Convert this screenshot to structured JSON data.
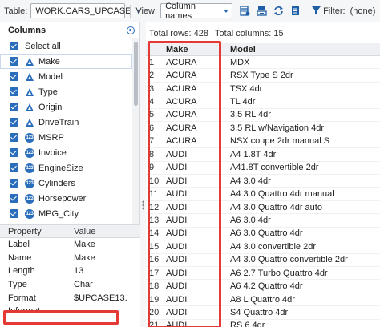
{
  "toolbar": {
    "table_label": "Table:",
    "table_value": "WORK.CARS_UPCASE",
    "view_label": "View:",
    "view_value": "Column names",
    "filter_label": "Filter:",
    "filter_value": "(none)",
    "icons": [
      "table-properties-icon",
      "export-icon",
      "refresh-icon",
      "column-list-icon",
      "filter-icon"
    ]
  },
  "columns_panel": {
    "title": "Columns",
    "select_all": "Select all",
    "items": [
      {
        "label": "Make",
        "type": "char"
      },
      {
        "label": "Model",
        "type": "char"
      },
      {
        "label": "Type",
        "type": "char"
      },
      {
        "label": "Origin",
        "type": "char"
      },
      {
        "label": "DriveTrain",
        "type": "char"
      },
      {
        "label": "MSRP",
        "type": "num"
      },
      {
        "label": "Invoice",
        "type": "num"
      },
      {
        "label": "EngineSize",
        "type": "num"
      },
      {
        "label": "Cylinders",
        "type": "num"
      },
      {
        "label": "Horsepower",
        "type": "num"
      },
      {
        "label": "MPG_City",
        "type": "num"
      }
    ],
    "numeric_badge": "123"
  },
  "properties": {
    "headers": [
      "Property",
      "Value"
    ],
    "rows": [
      {
        "property": "Label",
        "value": "Make"
      },
      {
        "property": "Name",
        "value": "Make"
      },
      {
        "property": "Length",
        "value": "13"
      },
      {
        "property": "Type",
        "value": "Char"
      },
      {
        "property": "Format",
        "value": "$UPCASE13."
      },
      {
        "property": "Informat",
        "value": ""
      }
    ]
  },
  "data_view": {
    "total_rows": "Total rows: 428",
    "total_columns": "Total columns: 15",
    "headers": [
      "",
      "Make",
      "Model"
    ],
    "rows": [
      [
        "1",
        "ACURA",
        "MDX"
      ],
      [
        "2",
        "ACURA",
        "RSX Type S 2dr"
      ],
      [
        "3",
        "ACURA",
        "TSX 4dr"
      ],
      [
        "4",
        "ACURA",
        "TL 4dr"
      ],
      [
        "5",
        "ACURA",
        "3.5 RL 4dr"
      ],
      [
        "6",
        "ACURA",
        "3.5 RL w/Navigation 4dr"
      ],
      [
        "7",
        "ACURA",
        "NSX coupe 2dr manual S"
      ],
      [
        "8",
        "AUDI",
        "A4 1.8T 4dr"
      ],
      [
        "9",
        "AUDI",
        "A41.8T convertible 2dr"
      ],
      [
        "10",
        "AUDI",
        "A4 3.0 4dr"
      ],
      [
        "11",
        "AUDI",
        "A4 3.0 Quattro 4dr manual"
      ],
      [
        "12",
        "AUDI",
        "A4 3.0 Quattro 4dr auto"
      ],
      [
        "13",
        "AUDI",
        "A6 3.0 4dr"
      ],
      [
        "14",
        "AUDI",
        "A6 3.0 Quattro 4dr"
      ],
      [
        "15",
        "AUDI",
        "A4 3.0 convertible 2dr"
      ],
      [
        "16",
        "AUDI",
        "A4 3.0 Quattro convertible 2dr"
      ],
      [
        "17",
        "AUDI",
        "A6 2.7 Turbo Quattro 4dr"
      ],
      [
        "18",
        "AUDI",
        "A6 4.2 Quattro 4dr"
      ],
      [
        "19",
        "AUDI",
        "A8 L Quattro 4dr"
      ],
      [
        "20",
        "AUDI",
        "S4 Quattro 4dr"
      ],
      [
        "21",
        "AUDI",
        "RS 6 4dr"
      ]
    ]
  },
  "colors": {
    "accent": "#2a6ebb",
    "highlight": "#e53935"
  }
}
